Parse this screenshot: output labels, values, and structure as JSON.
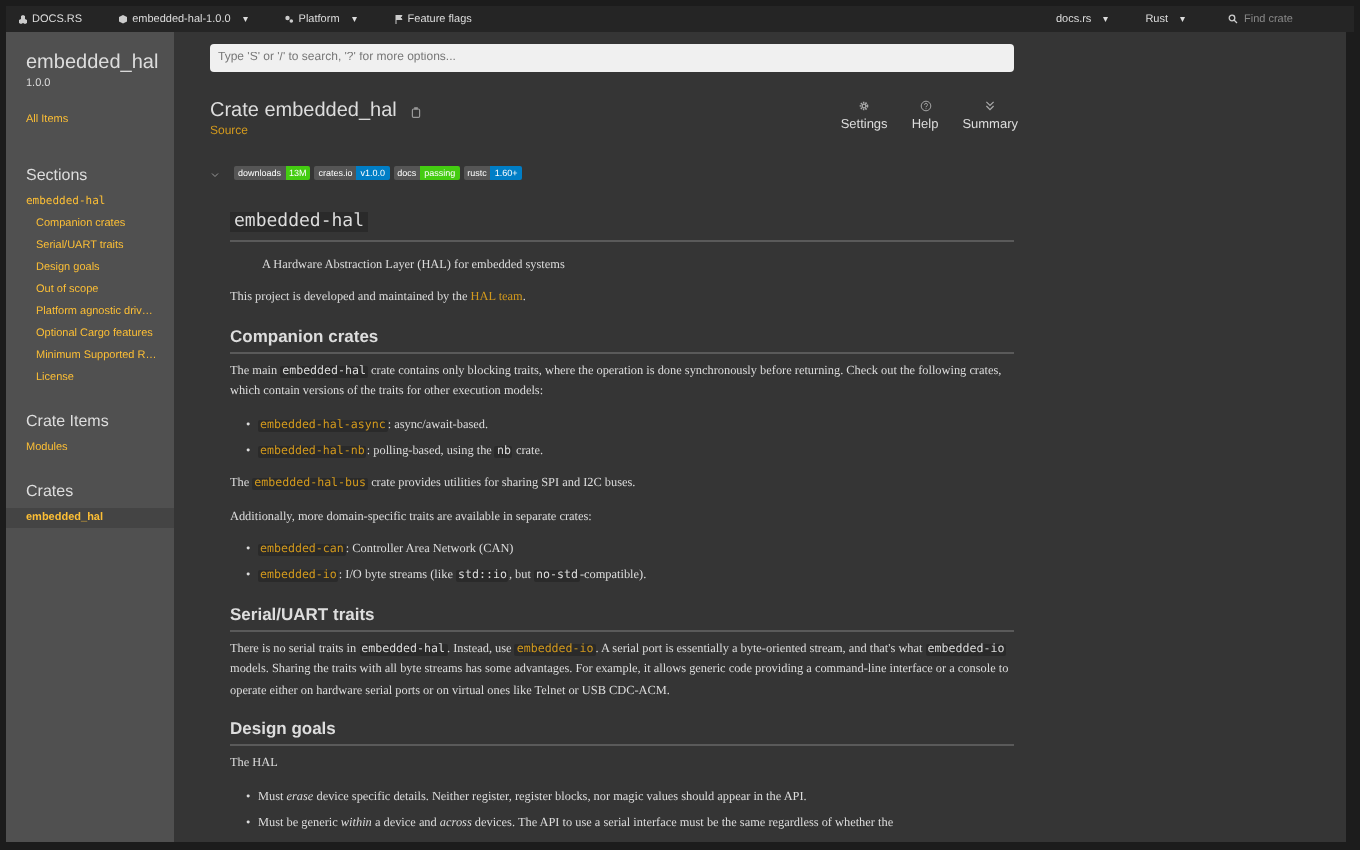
{
  "topbar": {
    "logo": "DOCS.RS",
    "crate_menu": {
      "label": "embedded-hal-1.0.0",
      "caret": "▾"
    },
    "platform_menu": {
      "label": "Platform",
      "caret": "▾"
    },
    "feature_flags": "Feature flags",
    "docs_menu": {
      "label": "docs.rs",
      "caret": "▾"
    },
    "rust_menu": {
      "label": "Rust",
      "caret": "▾"
    },
    "search": {
      "placeholder": "Find crate"
    }
  },
  "sidebar": {
    "crate": "embedded_hal",
    "version": "1.0.0",
    "all_items": "All Items",
    "sections": [
      {
        "heading": "Sections",
        "items": [
          {
            "label": "embedded-hal",
            "kind": "code",
            "selected": false,
            "children": [
              {
                "label": "Companion crates",
                "selected": false
              },
              {
                "label": "Serial/UART traits",
                "selected": false
              },
              {
                "label": "Design goals",
                "selected": false
              },
              {
                "label": "Out of scope",
                "selected": false
              },
              {
                "label": "Platform agnostic driv…",
                "selected": false
              },
              {
                "label": "Optional Cargo features",
                "selected": false
              },
              {
                "label": "Minimum Supported R…",
                "selected": false
              },
              {
                "label": "License",
                "selected": false
              }
            ]
          }
        ]
      },
      {
        "heading": "Crate Items",
        "items": [
          {
            "label": "Modules",
            "kind": "plain",
            "selected": false
          }
        ]
      },
      {
        "heading": "Crates",
        "items": [
          {
            "label": "embedded_hal",
            "kind": "plain",
            "selected": true
          }
        ]
      }
    ]
  },
  "search": {
    "placeholder": "Type 'S' or '/' to search, '?' for more options..."
  },
  "title": "Crate embedded_hal",
  "source_link": "Source",
  "tools": [
    {
      "label": "Settings",
      "kind": "gear"
    },
    {
      "label": "Help",
      "kind": "help"
    },
    {
      "label": "Summary",
      "kind": "summary"
    }
  ],
  "badges": [
    {
      "label": "downloads",
      "value": "13M",
      "color": "#44cc11"
    },
    {
      "label": "crates.io",
      "value": "v1.0.0",
      "color": "#007ec6"
    },
    {
      "label": "docs",
      "value": "passing",
      "color": "#44cc11"
    },
    {
      "label": "rustc",
      "value": "1.60+",
      "color": "#007ec6"
    }
  ],
  "blocks": [
    {
      "kind": "h1",
      "text": "embedded-hal"
    },
    {
      "kind": "quote",
      "segments": [
        {
          "kind": "text",
          "text": "A Hardware Abstraction Layer (HAL) for embedded systems"
        }
      ]
    },
    {
      "kind": "p",
      "segments": [
        {
          "kind": "text",
          "text": "This project is developed and maintained by the "
        },
        {
          "kind": "link",
          "text": "HAL team"
        },
        {
          "kind": "text",
          "text": "."
        }
      ]
    },
    {
      "kind": "h2",
      "text": "Companion crates"
    },
    {
      "kind": "p",
      "segments": [
        {
          "kind": "text",
          "text": "The main "
        },
        {
          "kind": "code",
          "text": "embedded-hal"
        },
        {
          "kind": "text",
          "text": " crate contains only blocking traits, where the operation is done synchronously before returning. Check out the following crates, which contain versions of the traits for other execution models:"
        }
      ]
    },
    {
      "kind": "ul",
      "bullet": "•",
      "items": [
        [
          {
            "kind": "codelink",
            "text": "embedded-hal-async"
          },
          {
            "kind": "text",
            "text": ": async/await-based."
          }
        ],
        [
          {
            "kind": "codelink",
            "text": "embedded-hal-nb"
          },
          {
            "kind": "text",
            "text": ": polling-based, using the "
          },
          {
            "kind": "code",
            "text": "nb"
          },
          {
            "kind": "text",
            "text": " crate."
          }
        ]
      ]
    },
    {
      "kind": "p",
      "segments": [
        {
          "kind": "text",
          "text": "The "
        },
        {
          "kind": "codelink",
          "text": "embedded-hal-bus"
        },
        {
          "kind": "text",
          "text": " crate provides utilities for sharing SPI and I2C buses."
        }
      ]
    },
    {
      "kind": "p",
      "segments": [
        {
          "kind": "text",
          "text": "Additionally, more domain-specific traits are available in separate crates:"
        }
      ]
    },
    {
      "kind": "ul",
      "bullet": "•",
      "items": [
        [
          {
            "kind": "codelink",
            "text": "embedded-can"
          },
          {
            "kind": "text",
            "text": ": Controller Area Network (CAN)"
          }
        ],
        [
          {
            "kind": "codelink",
            "text": "embedded-io"
          },
          {
            "kind": "text",
            "text": ": I/O byte streams (like "
          },
          {
            "kind": "code",
            "text": "std::io"
          },
          {
            "kind": "text",
            "text": ", but "
          },
          {
            "kind": "code",
            "text": "no-std"
          },
          {
            "kind": "text",
            "text": "-compatible)."
          }
        ]
      ]
    },
    {
      "kind": "h2",
      "text": "Serial/UART traits"
    },
    {
      "kind": "p",
      "segments": [
        {
          "kind": "text",
          "text": "There is no serial traits in "
        },
        {
          "kind": "code",
          "text": "embedded-hal"
        },
        {
          "kind": "text",
          "text": ". Instead, use "
        },
        {
          "kind": "codelink",
          "text": "embedded-io"
        },
        {
          "kind": "text",
          "text": ". A serial port is essentially a byte-oriented stream, and that's what "
        },
        {
          "kind": "code",
          "text": "embedded-io"
        },
        {
          "kind": "text",
          "text": " models. Sharing the traits with all byte streams has some advantages. For example, it allows generic code providing a command-line interface or a console to operate either on hardware serial ports or on virtual ones like Telnet or USB CDC-ACM."
        }
      ]
    },
    {
      "kind": "h2",
      "text": "Design goals"
    },
    {
      "kind": "p",
      "segments": [
        {
          "kind": "text",
          "text": "The HAL"
        }
      ]
    },
    {
      "kind": "ul",
      "bullet": "•",
      "items": [
        [
          {
            "kind": "text",
            "text": "Must *erase* device specific details. Neither register, register blocks, nor magic values should appear in the API."
          }
        ],
        [
          {
            "kind": "text",
            "text": "Must be generic *within* a device and *across* devices. The API to use a serial interface must be the same regardless of whether the"
          }
        ]
      ]
    }
  ]
}
